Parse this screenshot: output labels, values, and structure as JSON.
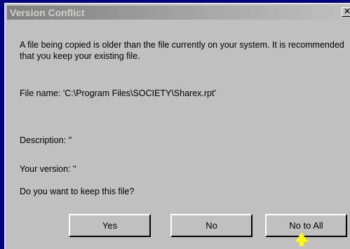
{
  "dialog": {
    "title": "Version Conflict",
    "close_glyph": "✕",
    "message": "A file being copied is older than the file currently on your system.  It is recommended that you keep your existing file.",
    "file_name_line": "File name:   'C:\\Program Files\\SOCIETY\\Sharex.rpt'",
    "description_line": "Description:  ''",
    "your_version_line": "Your version: ''",
    "question": "Do you want to keep this file?"
  },
  "buttons": {
    "yes": "Yes",
    "no": "No",
    "no_to_all": "No to All"
  },
  "colors": {
    "backdrop": "#00007e",
    "dialog_face": "#c0c0c0",
    "pointer": "#ffff00"
  },
  "icons": {
    "close": "close-icon",
    "pointer": "arrow-pointer-icon"
  }
}
